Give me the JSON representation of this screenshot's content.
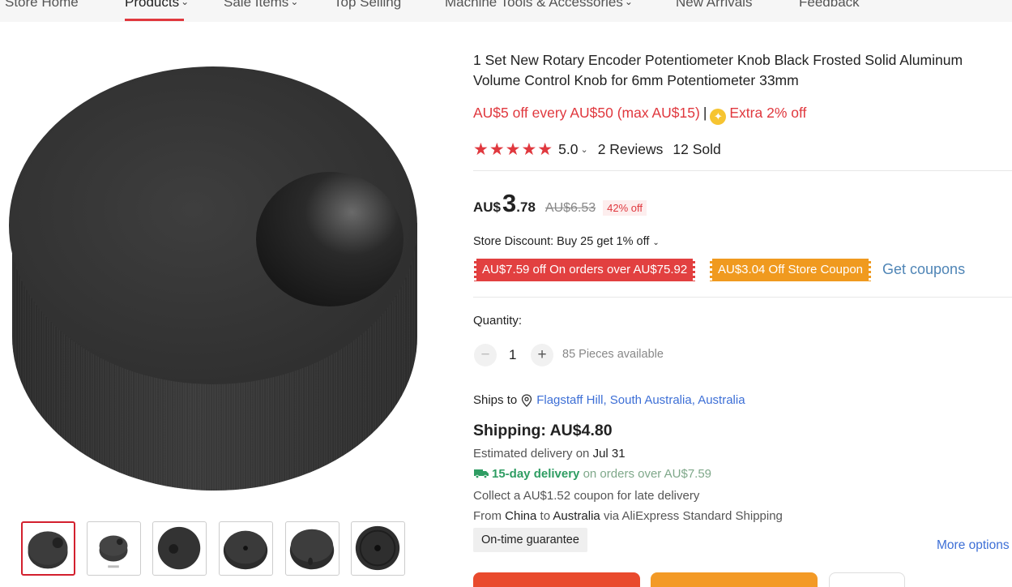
{
  "nav": {
    "items": [
      {
        "label": "Store Home",
        "dropdown": false,
        "active": false
      },
      {
        "label": "Products",
        "dropdown": true,
        "active": true
      },
      {
        "label": "Sale Items",
        "dropdown": true,
        "active": false
      },
      {
        "label": "Top Selling",
        "dropdown": false,
        "active": false
      },
      {
        "label": "Machine Tools & Accessories",
        "dropdown": true,
        "active": false
      },
      {
        "label": "New Arrivals",
        "dropdown": false,
        "active": false
      },
      {
        "label": "Feedback",
        "dropdown": false,
        "active": false
      }
    ]
  },
  "product": {
    "title": "1 Set New Rotary Encoder Potentiometer Knob Black Frosted Solid Aluminum Volume Control Knob for 6mm Potentiometer 33mm",
    "promo_main": "AU$5 off every AU$50 (max AU$15)",
    "promo_sep": "|",
    "promo_extra": "Extra 2% off",
    "rating_score": "5.0",
    "stars": "★★★★★",
    "reviews": "2 Reviews",
    "sold": "12 Sold",
    "price_currency": "AU$",
    "price_int": "3",
    "price_dec": ".78",
    "price_original": "AU$6.53",
    "price_discount": "42% off",
    "store_discount": "Store Discount: Buy 25 get 1% off",
    "coupon_1": "AU$7.59 off On orders over AU$75.92",
    "coupon_2": "AU$3.04 Off Store Coupon",
    "get_coupons": "Get coupons",
    "quantity_label": "Quantity:",
    "quantity_value": "1",
    "available": "85 Pieces available",
    "ships_to_label": "Ships to",
    "ships_to_location": "Flagstaff Hill, South Australia, Australia",
    "shipping": "Shipping: AU$4.80",
    "estimated_label": "Estimated delivery on",
    "estimated_date": "Jul 31",
    "delivery_fast": "15-day delivery",
    "delivery_rest": "on orders over AU$7.59",
    "late_coupon": "Collect a AU$1.52 coupon for late delivery",
    "from_label": "From",
    "from_country": "China",
    "to_label": "to",
    "to_country": "Australia",
    "via": "via AliExpress Standard Shipping",
    "ontime": "On-time guarantee",
    "more_options": "More options"
  },
  "colors": {
    "accent_red": "#e0383e",
    "coupon_red": "#e24040",
    "coupon_orange": "#f09a1f",
    "link_blue": "#3d6fd6",
    "delivery_green": "#2f9d63"
  },
  "icons": {
    "nav_dropdown": "chevron-down-icon",
    "coin": "coin-icon",
    "location": "location-pin-icon",
    "truck": "truck-icon"
  }
}
